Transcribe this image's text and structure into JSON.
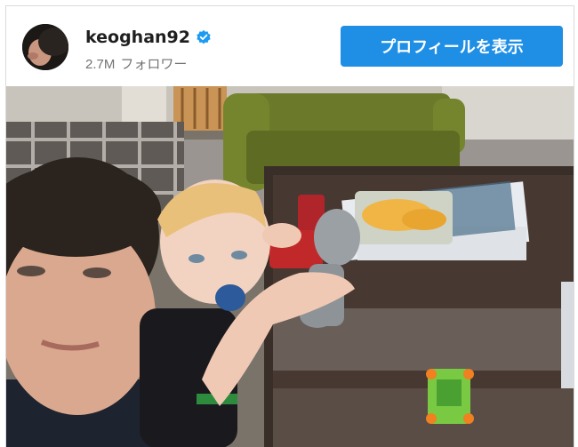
{
  "post": {
    "username": "keoghan92",
    "followers": "2.7M",
    "followers_label": "フォロワー",
    "profile_button": "プロフィールを表示"
  },
  "icons": {
    "verified": "verified-badge-icon"
  },
  "colors": {
    "button": "#1f8fe6",
    "verified": "#1d9bf0"
  }
}
